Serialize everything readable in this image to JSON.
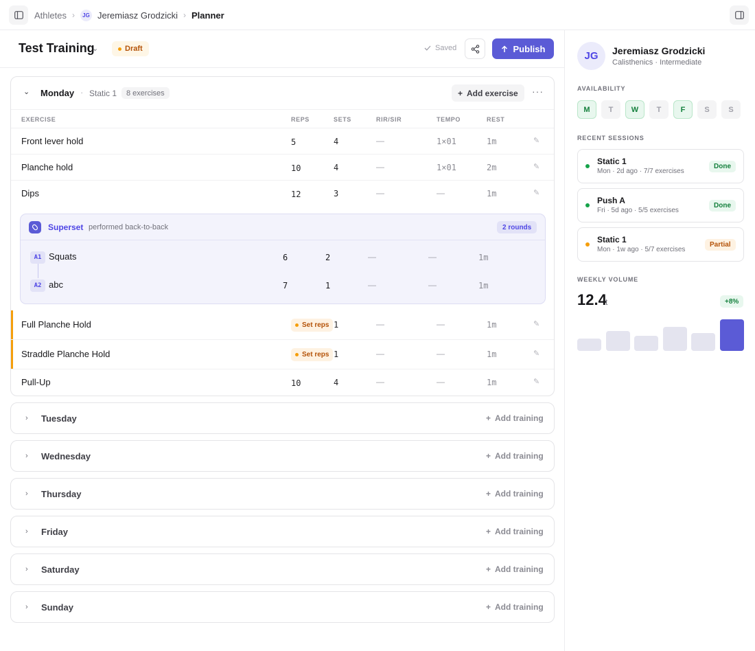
{
  "breadcrumb": {
    "root": "Athletes",
    "avatar_initials": "JG",
    "athlete": "Jeremiasz Grodzicki",
    "current": "Planner"
  },
  "header": {
    "title": "Test Training",
    "status": "Draft",
    "saved_label": "Saved",
    "publish_label": "Publish"
  },
  "columns": {
    "exercise": "EXERCISE",
    "reps": "REPS",
    "sets": "SETS",
    "rir": "RIR/SIR",
    "tempo": "TEMPO",
    "rest": "REST"
  },
  "monday": {
    "day": "Monday",
    "session": "Static 1",
    "count": "8 exercises",
    "add_exercise": "Add exercise",
    "rows": [
      {
        "name": "Front lever hold",
        "reps": "5",
        "sets": "4",
        "rir": "—",
        "tempo": "1×01",
        "rest": "1m"
      },
      {
        "name": "Planche hold",
        "reps": "10",
        "sets": "4",
        "rir": "—",
        "tempo": "1×01",
        "rest": "2m"
      },
      {
        "name": "Dips",
        "reps": "12",
        "sets": "3",
        "rir": "—",
        "tempo": "—",
        "rest": "1m"
      }
    ],
    "superset": {
      "title": "Superset",
      "subtitle": "performed back-to-back",
      "rounds": "2 rounds",
      "items": [
        {
          "badge": "A1",
          "name": "Squats",
          "reps": "6",
          "sets": "2",
          "rir": "—",
          "tempo": "—",
          "rest": "1m"
        },
        {
          "badge": "A2",
          "name": "abc",
          "reps": "7",
          "sets": "1",
          "rir": "—",
          "tempo": "—",
          "rest": "1m"
        }
      ]
    },
    "rows_after": [
      {
        "name": "Full Planche Hold",
        "badge": "Set reps",
        "sets": "1",
        "rir": "—",
        "tempo": "—",
        "rest": "1m"
      },
      {
        "name": "Straddle Planche Hold",
        "badge": "Set reps",
        "sets": "1",
        "rir": "—",
        "tempo": "—",
        "rest": "1m"
      },
      {
        "name": "Pull-Up",
        "reps": "10",
        "sets": "4",
        "rir": "—",
        "tempo": "—",
        "rest": "1m"
      }
    ]
  },
  "other_days": [
    {
      "day": "Tuesday",
      "action": "Add training"
    },
    {
      "day": "Wednesday",
      "action": "Add training"
    },
    {
      "day": "Thursday",
      "action": "Add training"
    },
    {
      "day": "Friday",
      "action": "Add training"
    },
    {
      "day": "Saturday",
      "action": "Add training"
    },
    {
      "day": "Sunday",
      "action": "Add training"
    }
  ],
  "sidebar": {
    "initials": "JG",
    "name": "Jeremiasz Grodzicki",
    "subtitle": "Calisthenics · Intermediate",
    "availability_label": "AVAILABILITY",
    "availability": [
      {
        "letter": "M",
        "on": true
      },
      {
        "letter": "T",
        "on": false
      },
      {
        "letter": "W",
        "on": true
      },
      {
        "letter": "T",
        "on": false
      },
      {
        "letter": "F",
        "on": true
      },
      {
        "letter": "S",
        "on": false
      },
      {
        "letter": "S",
        "on": false
      }
    ],
    "sessions_label": "RECENT SESSIONS",
    "sessions": [
      {
        "title": "Static 1",
        "meta": "Mon · 2d ago · 7/7 exercises",
        "status": "Done"
      },
      {
        "title": "Push A",
        "meta": "Fri · 5d ago · 5/5 exercises",
        "status": "Done"
      },
      {
        "title": "Static 1",
        "meta": "Mon · 1w ago · 5/7 exercises",
        "status": "Partial"
      }
    ],
    "volume_label": "WEEKLY VOLUME",
    "volume": "12.4",
    "volume_unit": "t",
    "volume_delta": "+8%",
    "volume_bars": [
      0.4,
      0.63,
      0.48,
      0.77,
      0.57,
      1.0
    ]
  },
  "colors": {
    "accent": "#5b5bd6",
    "done": "#16a34a",
    "partial": "#f59e0b"
  }
}
